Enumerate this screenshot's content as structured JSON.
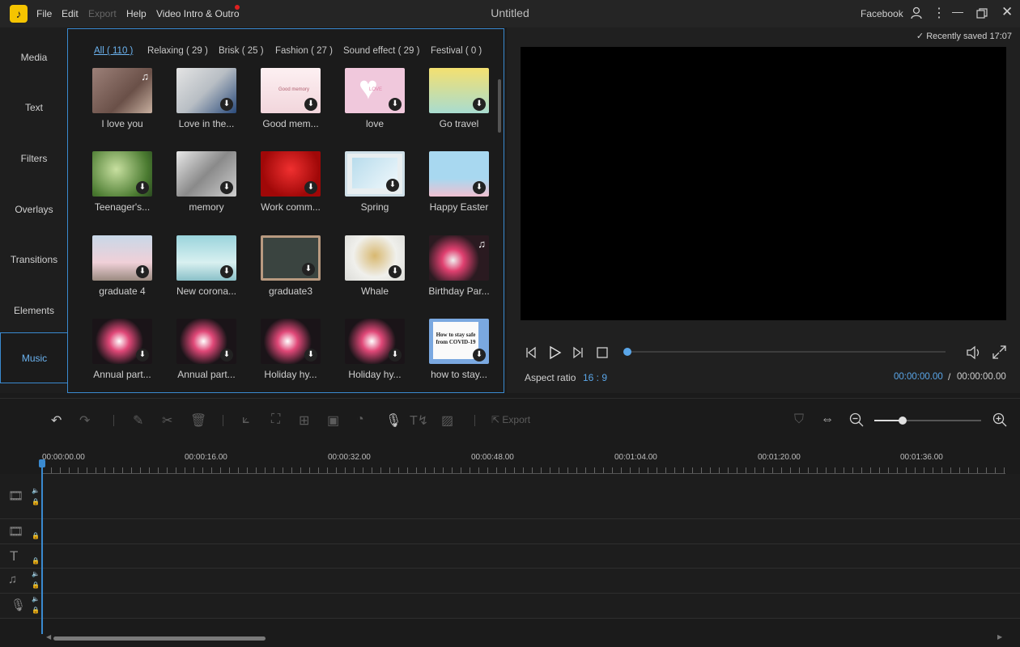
{
  "menu": {
    "file": "File",
    "edit": "Edit",
    "export": "Export",
    "help": "Help",
    "intro": "Video Intro & Outro"
  },
  "window": {
    "title": "Untitled",
    "account": "Facebook"
  },
  "sidebar": {
    "items": [
      "Media",
      "Text",
      "Filters",
      "Overlays",
      "Transitions",
      "Elements",
      "Music"
    ],
    "active": "Music"
  },
  "library": {
    "tabs": [
      "All ( 110 )",
      "Relaxing ( 29 )",
      "Brisk ( 25 )",
      "Fashion ( 27 )",
      "Sound effect ( 29 )",
      "Festival ( 0 )"
    ],
    "items": [
      {
        "name": "I love you",
        "icon": "music-note-icon"
      },
      {
        "name": "Love in the...",
        "icon": "download-icon"
      },
      {
        "name": "Good mem...",
        "icon": "download-icon",
        "thumb_text": "Good memory"
      },
      {
        "name": "love",
        "icon": "download-icon",
        "thumb_text": "LOVE"
      },
      {
        "name": "Go travel",
        "icon": "download-icon"
      },
      {
        "name": "Teenager's...",
        "icon": "download-icon"
      },
      {
        "name": "memory",
        "icon": "download-icon"
      },
      {
        "name": "Work comm...",
        "icon": "download-icon"
      },
      {
        "name": "Spring",
        "icon": "download-icon"
      },
      {
        "name": "Happy Easter",
        "icon": "download-icon"
      },
      {
        "name": "graduate 4",
        "icon": "download-icon"
      },
      {
        "name": "New corona...",
        "icon": "download-icon"
      },
      {
        "name": "graduate3",
        "icon": "download-icon"
      },
      {
        "name": "Whale",
        "icon": "download-icon"
      },
      {
        "name": "Birthday Par...",
        "icon": "music-note-icon"
      },
      {
        "name": "Annual part...",
        "icon": "download-icon"
      },
      {
        "name": "Annual part...",
        "icon": "download-icon"
      },
      {
        "name": "Holiday hy...",
        "icon": "download-icon"
      },
      {
        "name": "Holiday hy...",
        "icon": "download-icon"
      },
      {
        "name": "how to stay...",
        "icon": "download-icon",
        "thumb_text": "How to stay safe from COVID-19"
      }
    ]
  },
  "preview": {
    "saved": "Recently saved 17:07",
    "aspect_label": "Aspect ratio",
    "aspect_value": "16 : 9",
    "time_current": "00:00:00.00",
    "time_separator": "/",
    "time_total": "00:00:00.00",
    "progress": 0
  },
  "toolbar": {
    "export_label": "Export",
    "zoom_level": 0.25
  },
  "timeline": {
    "ruler": [
      "00:00:00.00",
      "00:00:16.00",
      "00:00:32.00",
      "00:00:48.00",
      "00:01:04.00",
      "00:01:20.00",
      "00:01:36.00"
    ]
  },
  "colors": {
    "accent": "#3a8ad0",
    "accent_text": "#5aa6e8",
    "logo": "#f5c400"
  }
}
